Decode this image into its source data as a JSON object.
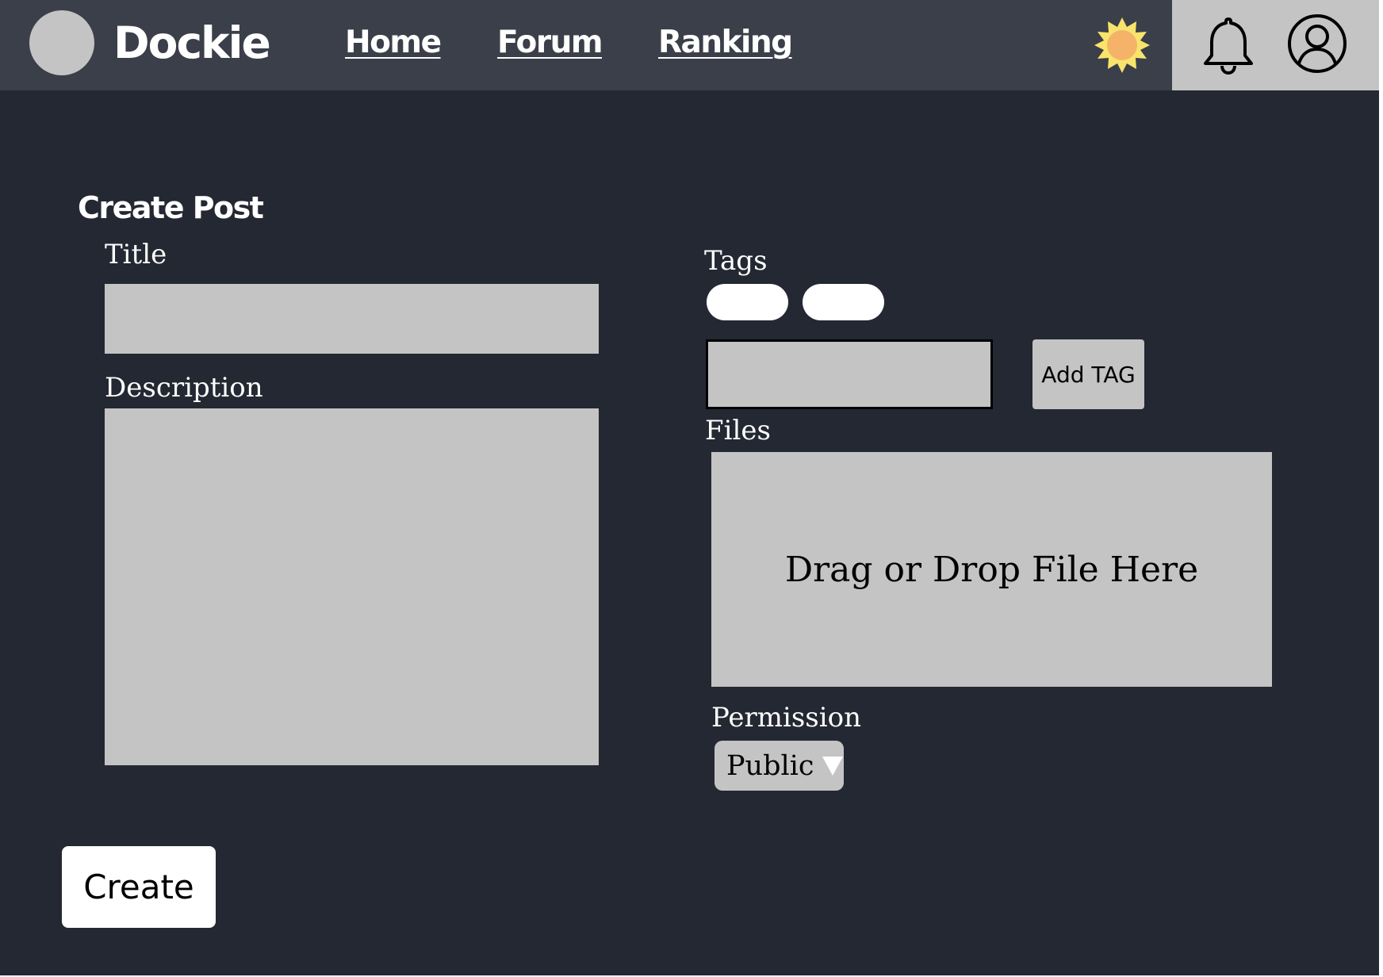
{
  "app": {
    "brand": "Dockie"
  },
  "nav": {
    "items": [
      {
        "label": "Home"
      },
      {
        "label": "Forum"
      },
      {
        "label": "Ranking"
      }
    ]
  },
  "header_icons": {
    "theme": "sun-icon",
    "notifications": "bell-icon",
    "profile": "user-circle-icon"
  },
  "form": {
    "heading": "Create Post",
    "title_label": "Title",
    "title_value": "",
    "description_label": "Description",
    "description_value": "",
    "tags_label": "Tags",
    "tag_input_value": "",
    "add_tag_label": "Add TAG",
    "files_label": "Files",
    "dropzone_text": "Drag or Drop File Here",
    "permission_label": "Permission",
    "permission_value": "Public",
    "create_label": "Create"
  },
  "colors": {
    "background": "#242832",
    "header": "#3b3f49",
    "field": "#c4c4c4",
    "sun": "#f8e46c",
    "sun_core": "#f5b36a"
  }
}
